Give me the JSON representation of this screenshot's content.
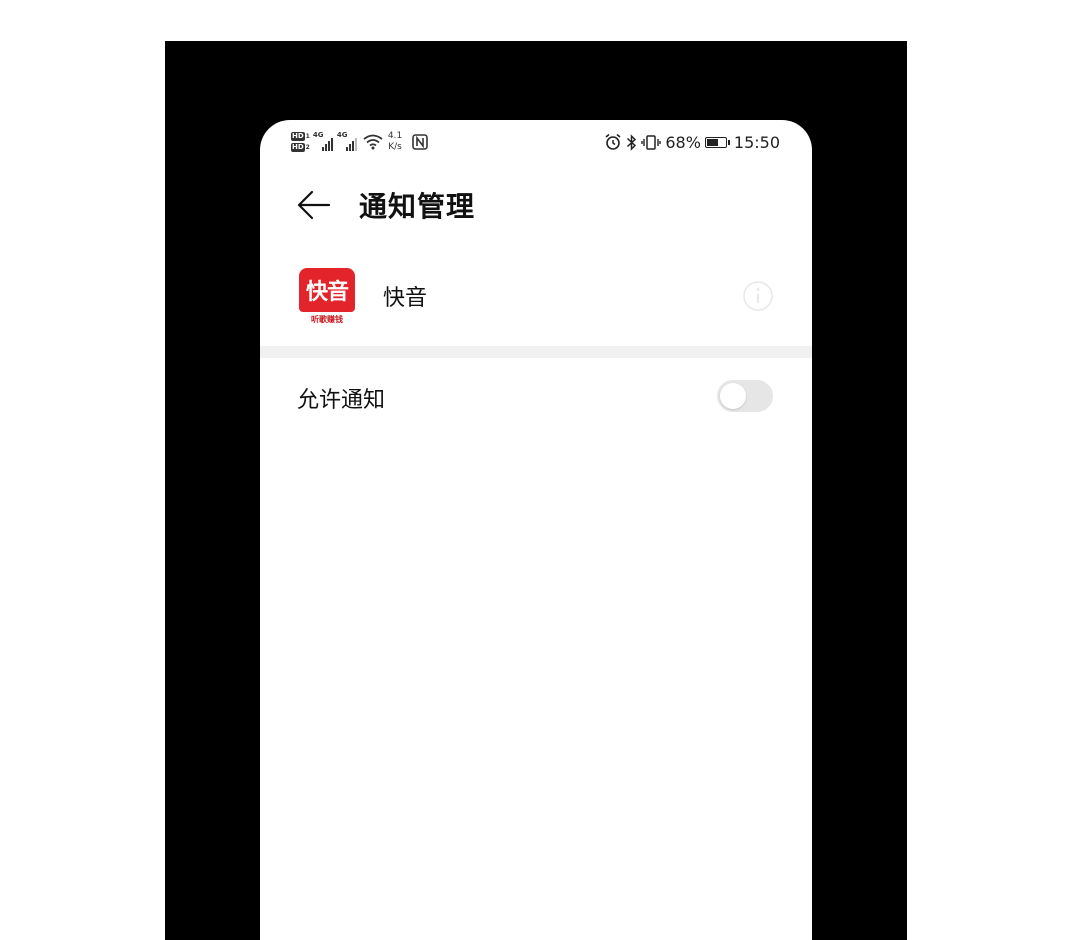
{
  "status_bar": {
    "hd_badge": "HD",
    "sim1": "1",
    "sim2": "2",
    "net1": "4G",
    "net2": "4G",
    "speed_value": "4.1",
    "speed_unit": "K/s",
    "battery_percent": "68%",
    "battery_level": 0.68,
    "time": "15:50",
    "icons": [
      "hd-icon",
      "signal-icon",
      "wifi-icon",
      "nfc-icon",
      "alarm-icon",
      "bluetooth-icon",
      "vibrate-icon",
      "battery-icon"
    ]
  },
  "header": {
    "title": "通知管理",
    "back_icon": "arrow-left-icon"
  },
  "app": {
    "icon_text": "快音",
    "icon_subtext": "听歌赚钱",
    "icon_color": "#e3242b",
    "name": "快音",
    "info_icon": "info-icon"
  },
  "settings": {
    "allow_notifications_label": "允许通知",
    "allow_notifications_enabled": false
  }
}
